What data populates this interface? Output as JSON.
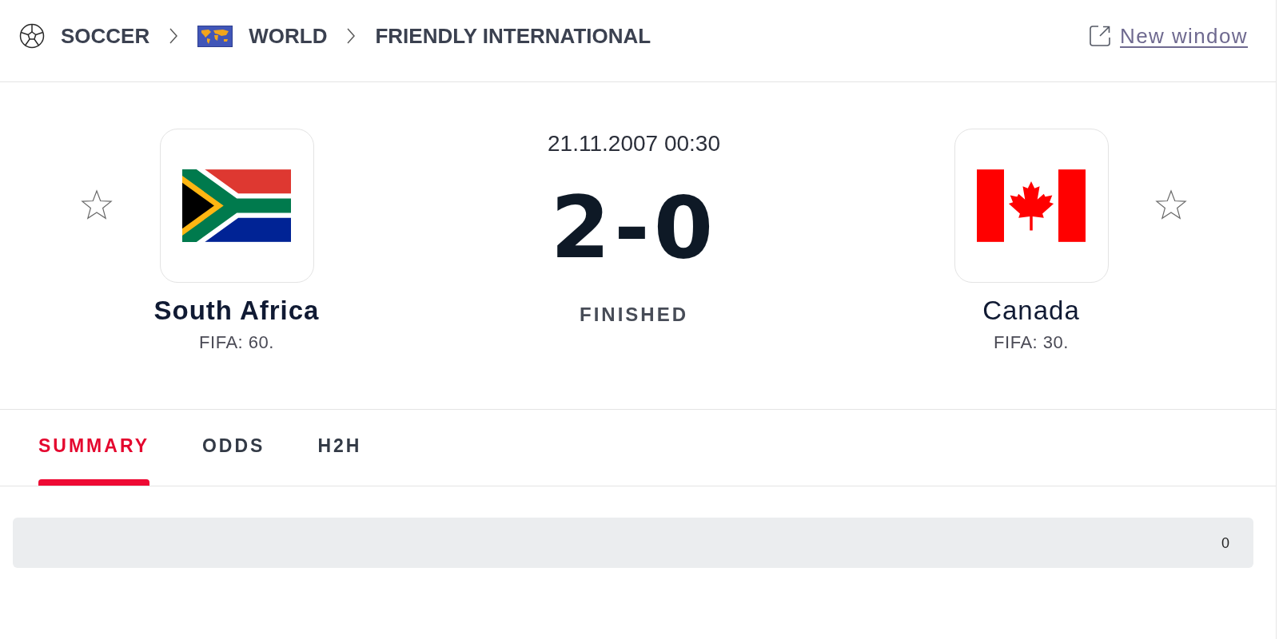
{
  "breadcrumb": [
    {
      "kind": "sport",
      "label": "SOCCER"
    },
    {
      "kind": "region",
      "label": "WORLD"
    },
    {
      "kind": "competition",
      "label": "FRIENDLY INTERNATIONAL"
    }
  ],
  "new_window_link": {
    "label": "New window"
  },
  "match": {
    "date_time": "21.11.2007 00:30",
    "score": "2-0",
    "status": "FINISHED"
  },
  "teams": [
    {
      "kind": "za",
      "name": "South Africa",
      "ranking": "FIFA: 60.",
      "winner": true,
      "favorite": false
    },
    {
      "kind": "ca",
      "name": "Canada",
      "ranking": "FIFA: 30.",
      "winner": false,
      "favorite": false
    }
  ],
  "tabs": [
    {
      "label": "SUMMARY",
      "selected": true
    },
    {
      "label": "ODDS",
      "selected": false
    },
    {
      "label": "H2H",
      "selected": false
    }
  ],
  "summary_row": {
    "value": "0"
  }
}
